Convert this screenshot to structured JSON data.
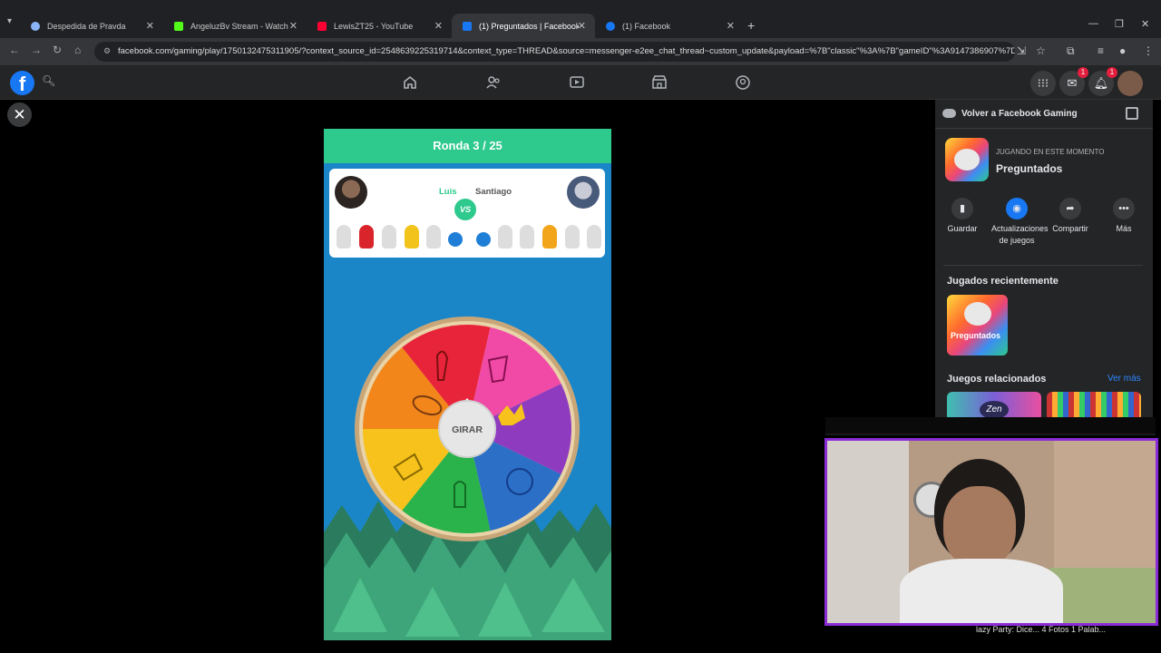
{
  "browser": {
    "tabs": [
      {
        "title": "Despedida de Pravda",
        "color": "#8ab4f8"
      },
      {
        "title": "AngeluzBv Stream - Watch Live",
        "color": "#53fc18"
      },
      {
        "title": "LewisZT25 - YouTube",
        "color": "#ff0033"
      },
      {
        "title": "(1) Preguntados | Facebook",
        "color": "#1877f2"
      },
      {
        "title": "(1) Facebook",
        "color": "#1877f2"
      }
    ],
    "url": "facebook.com/gaming/play/1750132475311905/?context_source_id=2548639225319714&context_type=THREAD&source=messenger-e2ee_chat_thread~custom_update&payload=%7B\"classic\"%3A%7B\"gameID\"%3A9147386907%7D%2..."
  },
  "facebook": {
    "notification_count": "1",
    "messenger_count": "1"
  },
  "game": {
    "round": "Ronda 3 / 25",
    "player1": "Luis",
    "player2": "Santiago",
    "vs": "VS",
    "spin_label": "GIRAR"
  },
  "sidebar": {
    "back_label": "Volver a Facebook Gaming",
    "playing_now": "JUGANDO EN ESTE MOMENTO",
    "game_name": "Preguntados",
    "actions": [
      {
        "label": "Guardar",
        "icon": "bookmark-icon"
      },
      {
        "label": "Actualizaciones de juegos",
        "icon": "messenger-icon"
      },
      {
        "label": "Compartir",
        "icon": "share-icon"
      },
      {
        "label": "Más",
        "icon": "more-icon"
      }
    ],
    "recent_title": "Jugados recientemente",
    "recent_game": "Preguntados",
    "related_title": "Juegos relacionados",
    "see_more": "Ver más",
    "related_game_badge": "Zen"
  },
  "overlay": {
    "caption": "lazy Party: Dice... 4 Fotos 1 Palab..."
  }
}
